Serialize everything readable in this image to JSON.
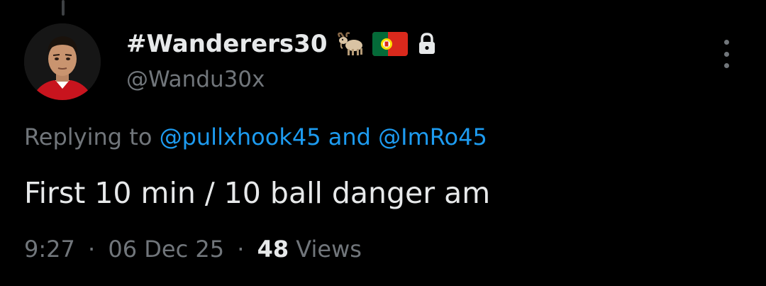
{
  "tweet": {
    "display_name": "#Wanderers30",
    "name_emojis": [
      "goat-emoji",
      "portugal-flag-emoji"
    ],
    "protected_icon": "lock-icon",
    "handle": "@Wandu30x",
    "more_icon": "more-options-icon",
    "replying_prefix": "Replying to",
    "reply_mention_1": "@pullxhook45",
    "reply_joiner": "and",
    "reply_mention_2": "@ImRo45",
    "text": "First 10 min / 10 ball danger am",
    "time": "9:27",
    "separator": "·",
    "date": "06 Dec 25",
    "views_count": "48",
    "views_label": "Views"
  },
  "colors": {
    "background": "#000000",
    "primary_text": "#e7e9ea",
    "secondary_text": "#71767b",
    "link": "#1d9bf0"
  }
}
